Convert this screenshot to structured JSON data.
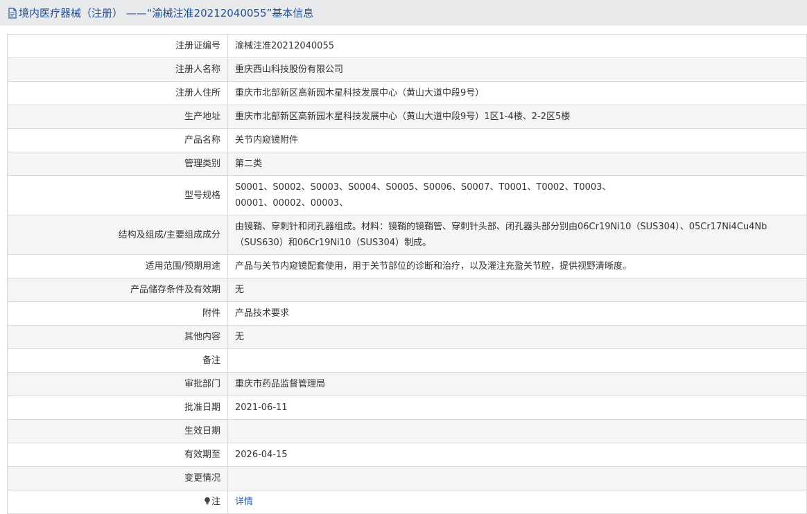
{
  "title": "境内医疗器械（注册） ——“渝械注准20212040055”基本信息",
  "rows": [
    {
      "label": "注册证编号",
      "value": "渝械注准20212040055"
    },
    {
      "label": "注册人名称",
      "value": "重庆西山科技股份有限公司"
    },
    {
      "label": "注册人住所",
      "value": "重庆市北部新区高新园木星科技发展中心（黄山大道中段9号）"
    },
    {
      "label": "生产地址",
      "value": "重庆市北部新区高新园木星科技发展中心（黄山大道中段9号）1区1-4楼、2-2区5楼"
    },
    {
      "label": "产品名称",
      "value": "关节内窥镜附件"
    },
    {
      "label": "管理类别",
      "value": "第二类"
    },
    {
      "label": "型号规格",
      "value_line1": "S0001、S0002、S0003、S0004、S0005、S0006、S0007、T0001、T0002、T0003、",
      "value_line2": "00001、00002、00003、"
    },
    {
      "label": "结构及组成/主要组成成分",
      "value_line1": "由镜鞘、穿刺针和闭孔器组成。材料：镜鞘的镜鞘管、穿刺针头部、闭孔器头部分别由06Cr19Ni10（SUS304）、05Cr17Ni4Cu4Nb",
      "value_line2": "（SUS630）和06Cr19Ni10（SUS304）制成。"
    },
    {
      "label": "适用范围/预期用途",
      "value": "产品与关节内窥镜配套使用，用于关节部位的诊断和治疗，以及灌注充盈关节腔，提供视野清晰度。"
    },
    {
      "label": "产品储存条件及有效期",
      "value": "无"
    },
    {
      "label": "附件",
      "value": "产品技术要求"
    },
    {
      "label": "其他内容",
      "value": "无"
    },
    {
      "label": "备注",
      "value": ""
    },
    {
      "label": "审批部门",
      "value": "重庆市药品监督管理局"
    },
    {
      "label": "批准日期",
      "value": "2021-06-11"
    },
    {
      "label": "生效日期",
      "value": ""
    },
    {
      "label": "有效期至",
      "value": "2026-04-15"
    },
    {
      "label": "变更情况",
      "value": ""
    },
    {
      "label": "注",
      "value": "详情"
    }
  ],
  "icons": {
    "title_icon": "document-icon",
    "note_icon": "lightbulb-icon"
  },
  "colors": {
    "title_text": "#1f4e96",
    "link": "#1f5fbf",
    "row_alt": "#f5f5f5",
    "border": "#d9d9d9"
  }
}
